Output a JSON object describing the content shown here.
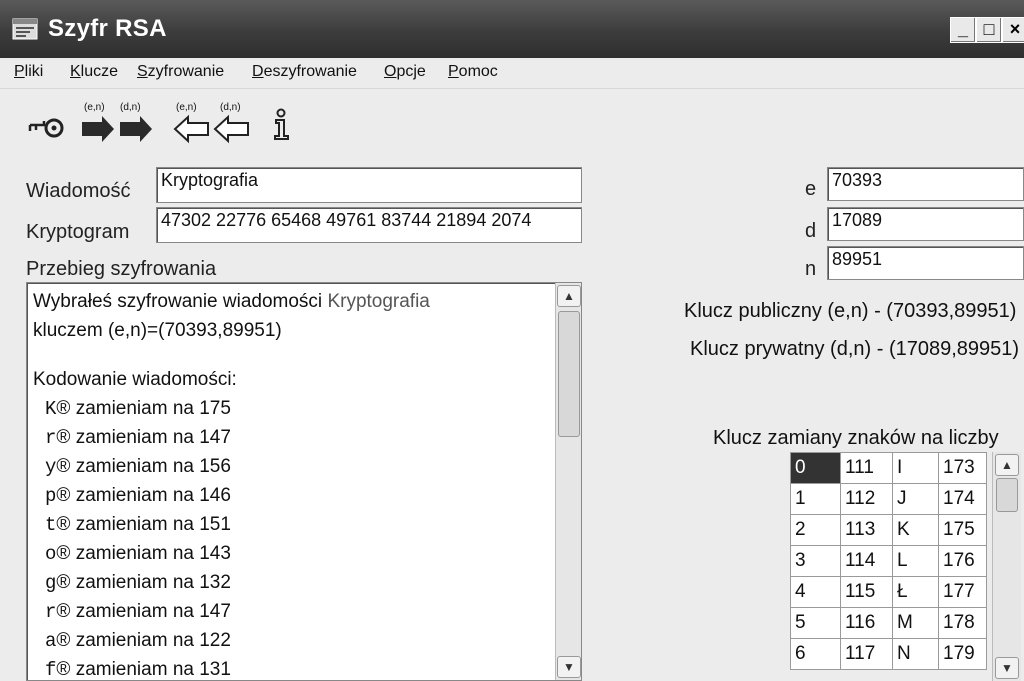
{
  "window": {
    "title": "Szyfr RSA",
    "icon": "app-window-icon",
    "controls": [
      "_",
      "□",
      "×"
    ]
  },
  "menu": [
    {
      "label": "Pliki"
    },
    {
      "label": "Klucze"
    },
    {
      "label": "Szyfrowanie"
    },
    {
      "label": "Deszyfrowanie"
    },
    {
      "label": "Opcje"
    },
    {
      "label": "Pomoc"
    }
  ],
  "toolbar": {
    "key_icon": "key-icon",
    "encrypt_en": "(e,n)",
    "encrypt_dn": "(d,n)",
    "decrypt_en": "(e,n)",
    "decrypt_dn": "(d,n)",
    "info_icon": "info-icon"
  },
  "form": {
    "message_label": "Wiadomość",
    "message_value": "Kryptografia",
    "cryptogram_label": "Kryptogram",
    "cryptogram_value": "47302 22776 65468 49761 83744 21894 2074",
    "log_label": "Przebieg szyfrowania"
  },
  "log": {
    "intro_prefix": "Wybrałeś szyfrowanie wiadomości ",
    "intro_word": "Kryptografia",
    "intro_line2": "kluczem (e,n)=(70393,89951)",
    "heading": "Kodowanie wiadomości:",
    "symbol": "®",
    "conversions": [
      {
        "char": "K",
        "text": "zamieniam na 175"
      },
      {
        "char": "r",
        "text": "zamieniam na 147"
      },
      {
        "char": "y",
        "text": "zamieniam na 156"
      },
      {
        "char": "p",
        "text": "zamieniam na 146"
      },
      {
        "char": "t",
        "text": "zamieniam na 151"
      },
      {
        "char": "o",
        "text": "zamieniam na 143"
      },
      {
        "char": "g",
        "text": "zamieniam na 132"
      },
      {
        "char": "r",
        "text": "zamieniam na 147"
      },
      {
        "char": "a",
        "text": "zamieniam na 122"
      },
      {
        "char": "f",
        "text": "zamieniam na 131"
      }
    ]
  },
  "keys": {
    "e_label": "e",
    "e_value": "70393",
    "d_label": "d",
    "d_value": "17089",
    "n_label": "n",
    "n_value": "89951",
    "public": "Klucz publiczny (e,n) - (70393,89951)",
    "private": "Klucz prywatny (d,n) - (17089,89951)"
  },
  "mapping": {
    "title": "Klucz zamiany znaków na liczby",
    "rows": [
      [
        "0",
        "111",
        "I",
        "173"
      ],
      [
        "1",
        "112",
        "J",
        "174"
      ],
      [
        "2",
        "113",
        "K",
        "175"
      ],
      [
        "3",
        "114",
        "L",
        "176"
      ],
      [
        "4",
        "115",
        "Ł",
        "177"
      ],
      [
        "5",
        "116",
        "M",
        "178"
      ],
      [
        "6",
        "117",
        "N",
        "179"
      ]
    ]
  }
}
